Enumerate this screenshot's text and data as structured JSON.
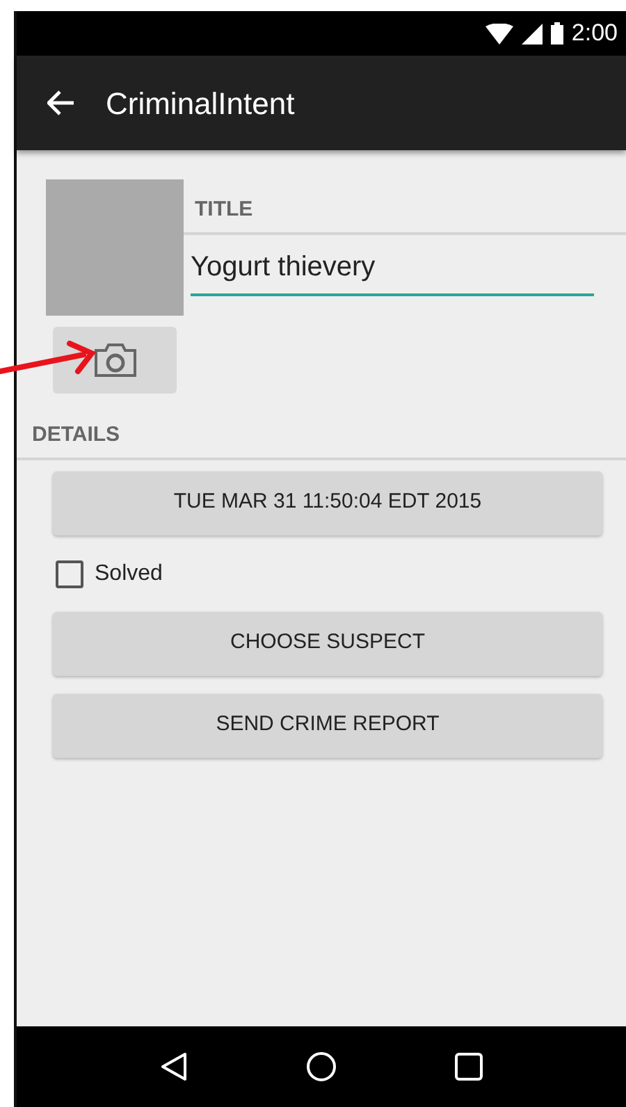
{
  "status_bar": {
    "time": "2:00"
  },
  "toolbar": {
    "title": "CriminalIntent"
  },
  "title_section": {
    "label": "TITLE",
    "value": "Yogurt thievery"
  },
  "details": {
    "label": "DETAILS",
    "date_button": "TUE MAR 31 11:50:04 EDT 2015",
    "solved": {
      "label": "Solved",
      "checked": false
    },
    "buttons": [
      "CHOOSE SUSPECT",
      "SEND CRIME REPORT"
    ]
  }
}
